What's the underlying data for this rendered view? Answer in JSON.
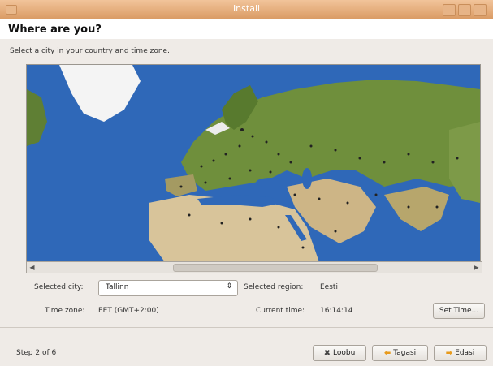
{
  "window": {
    "title": "Install"
  },
  "page": {
    "heading": "Where are you?",
    "subtitle": "Select a city in your country and time zone."
  },
  "location": {
    "selected_city_label": "Selected city:",
    "selected_city_value": "Tallinn",
    "selected_region_label": "Selected region:",
    "selected_region_value": "Eesti",
    "time_zone_label": "Time zone:",
    "time_zone_value": "EET (GMT+2:00)",
    "current_time_label": "Current time:",
    "current_time_value": "16:14:14",
    "set_time_button": "Set Time..."
  },
  "footer": {
    "step": "Step 2 of 6",
    "cancel_button": "Loobu",
    "back_button": "Tagasi",
    "forward_button": "Edasi"
  },
  "colors": {
    "titlebar": "#d99a63",
    "ocean": "#2f68b8",
    "land": "#6f8f3c",
    "desert": "#d8c49a",
    "ice": "#f4f4f4"
  },
  "icons": {
    "cancel": "x-icon",
    "back": "arrow-left-icon",
    "forward": "arrow-right-icon"
  }
}
